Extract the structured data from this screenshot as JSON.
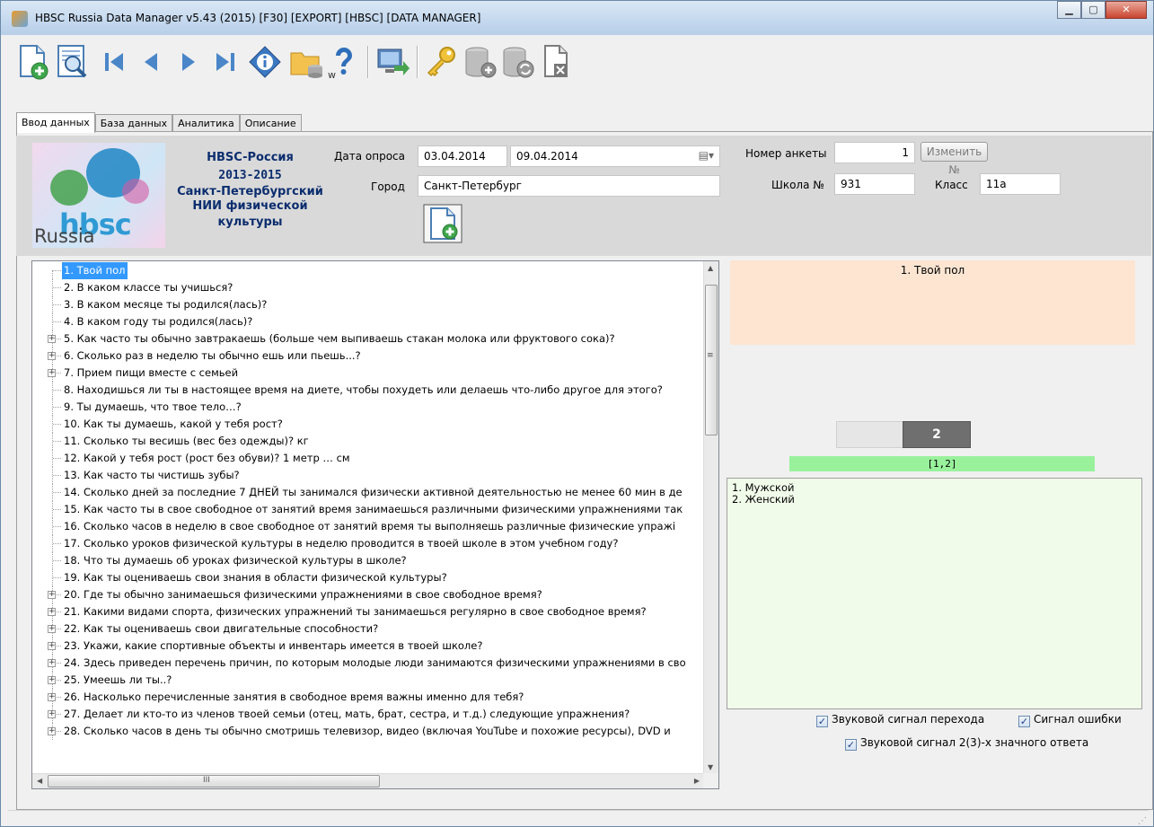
{
  "window": {
    "title": "HBSC Russia Data Manager v5.43 (2015) [F30] [EXPORT]  [HBSC]  [DATA MANAGER]"
  },
  "toolbar": {
    "icons": [
      "new-record-icon",
      "preview-icon",
      "first-record-icon",
      "previous-record-icon",
      "next-record-icon",
      "last-record-icon",
      "info-icon",
      "open-database-icon",
      "help-icon",
      "export-icon",
      "key-icon",
      "add-database-icon",
      "sync-database-icon",
      "delete-file-icon"
    ]
  },
  "tabs": [
    {
      "label": "Ввод данных",
      "active": true
    },
    {
      "label": "База данных",
      "active": false
    },
    {
      "label": "Аналитика",
      "active": false
    },
    {
      "label": "Описание",
      "active": false
    }
  ],
  "logo": {
    "line1": "hbsc",
    "line2": "Russia"
  },
  "org": {
    "line1": "HBSC-Россия",
    "line2": "2013-2015",
    "line3": "Санкт-Петербургский",
    "line4": "НИИ физической",
    "line5": "культуры"
  },
  "form": {
    "date_label": "Дата опроса",
    "date_from": "03.04.2014",
    "date_to": "09.04.2014",
    "city_label": "Город",
    "city_value": "Санкт-Петербург",
    "form_no_label": "Номер анкеты",
    "form_no_value": "1",
    "change_no_button": "Изменить №",
    "school_label": "Школа №",
    "school_value": "931",
    "class_label": "Класс",
    "class_value": "11а"
  },
  "questions": [
    {
      "text": "1. Твой пол",
      "expandable": false,
      "selected": true
    },
    {
      "text": "2. В каком классе ты учишься?",
      "expandable": false
    },
    {
      "text": "3. В каком месяце ты родился(лась)?",
      "expandable": false
    },
    {
      "text": "4. В каком году ты родился(лась)?",
      "expandable": false
    },
    {
      "text": "5. Как часто ты обычно завтракаешь (больше чем выпиваешь стакан молока или фруктового сока)?",
      "expandable": true
    },
    {
      "text": "6. Сколько раз в неделю ты обычно ешь или пьешь...?",
      "expandable": true
    },
    {
      "text": "7. Прием пищи вместе с семьей",
      "expandable": true
    },
    {
      "text": "8. Находишься ли ты в настоящее время на диете, чтобы похудеть или делаешь что-либо другое для этого?",
      "expandable": false
    },
    {
      "text": "9. Ты думаешь, что твое тело…?",
      "expandable": false
    },
    {
      "text": "10. Как ты думаешь, какой у тебя рост?",
      "expandable": false
    },
    {
      "text": "11. Сколько ты весишь (вес без одежды)? кг",
      "expandable": false
    },
    {
      "text": "12. Какой у тебя рост (рост без обуви)?  1 метр … см",
      "expandable": false
    },
    {
      "text": "13. Как часто ты чистишь зубы?",
      "expandable": false
    },
    {
      "text": "14. Сколько дней за последние 7 ДНЕЙ ты занимался физически активной деятельностью не менее 60 мин в де",
      "expandable": false
    },
    {
      "text": "15. Как часто ты в свое свободное от занятий время занимаешься различными физическими упражнениями так",
      "expandable": false
    },
    {
      "text": "16. Сколько часов в неделю в свое свободное от занятий время ты выполняешь различные физические упражі",
      "expandable": false
    },
    {
      "text": "17. Сколько уроков физической культуры в неделю проводится в твоей школе в этом учебном году?",
      "expandable": false
    },
    {
      "text": "18. Что ты думаешь об уроках физической культуры в школе?",
      "expandable": false
    },
    {
      "text": "19. Как ты оцениваешь свои знания в области физической культуры?",
      "expandable": false
    },
    {
      "text": "20. Где ты обычно занимаешься физическими упражнениями в свое свободное время?",
      "expandable": true
    },
    {
      "text": "21. Какими видами спорта, физических упражнений ты занимаешься регулярно в свое свободное время?",
      "expandable": true
    },
    {
      "text": "22. Как ты оцениваешь свои двигательные способности?",
      "expandable": true
    },
    {
      "text": "23. Укажи, какие спортивные объекты и инвентарь имеется в твоей школе?",
      "expandable": true
    },
    {
      "text": "24. Здесь приведен перечень причин, по которым молодые люди занимаются физическими упражнениями в сво",
      "expandable": true
    },
    {
      "text": "25. Умеешь ли ты..?",
      "expandable": true
    },
    {
      "text": "26. Насколько перечисленные занятия в свободное время важны именно для тебя?",
      "expandable": true
    },
    {
      "text": "27. Делает ли кто-то из членов твоей семьи (отец, мать, брат, сестра, и т.д.) следующие упражнения?",
      "expandable": true
    },
    {
      "text": "28. Сколько часов в день ты обычно смотришь телевизор, видео (включая YouTube и похожие ресурсы), DVD и",
      "expandable": true
    }
  ],
  "current_question": {
    "title": "1. Твой пол",
    "answer_input": "",
    "answer_value": "2",
    "range": "[1,2]",
    "options": [
      "1. Мужской",
      "2. Женский"
    ]
  },
  "options": {
    "sound_transition": "Звуковой сигнал перехода",
    "error_signal": "Сигнал ошибки",
    "sound_multidigit": "Звуковой сигнал 2(3)-х значного ответа"
  },
  "scrollbar_glyph": "III"
}
